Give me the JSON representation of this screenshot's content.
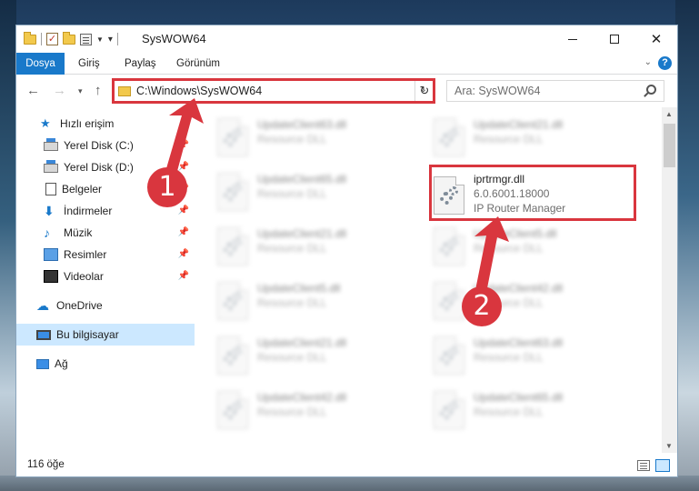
{
  "window": {
    "title": "SysWOW64"
  },
  "ribbon": {
    "tabs": [
      {
        "label": "Dosya"
      },
      {
        "label": "Giriş"
      },
      {
        "label": "Paylaş"
      },
      {
        "label": "Görünüm"
      }
    ],
    "help": "?"
  },
  "address": {
    "path": "C:\\Windows\\SysWOW64",
    "search_placeholder": "Ara: SysWOW64"
  },
  "sidebar": {
    "items": [
      {
        "label": "Hızlı erişim",
        "icon": "star-icon",
        "pinned": false
      },
      {
        "label": "Yerel Disk (C:)",
        "icon": "disk-icon",
        "pinned": true
      },
      {
        "label": "Yerel Disk (D:)",
        "icon": "disk-icon",
        "pinned": true
      },
      {
        "label": "Belgeler",
        "icon": "document-icon",
        "pinned": true
      },
      {
        "label": "İndirmeler",
        "icon": "download-icon",
        "pinned": true
      },
      {
        "label": "Müzik",
        "icon": "music-icon",
        "pinned": true
      },
      {
        "label": "Resimler",
        "icon": "pictures-icon",
        "pinned": true
      },
      {
        "label": "Videolar",
        "icon": "video-icon",
        "pinned": true
      },
      {
        "label": "OneDrive",
        "icon": "cloud-icon",
        "pinned": false
      },
      {
        "label": "Bu bilgisayar",
        "icon": "computer-icon",
        "pinned": false,
        "selected": true
      },
      {
        "label": "Ağ",
        "icon": "network-icon",
        "pinned": false
      }
    ]
  },
  "files": {
    "left_column": [
      {
        "name": "UpdateClient63.dll",
        "type": "Resource DLL"
      },
      {
        "name": "UpdateClient65.dll",
        "type": "Resource DLL"
      },
      {
        "name": "UpdateClient21.dll",
        "type": "Resource DLL"
      },
      {
        "name": "UpdateClient5.dll",
        "type": "Resource DLL"
      },
      {
        "name": "UpdateClient21.dll",
        "type": "Resource DLL"
      },
      {
        "name": "UpdateClient42.dll",
        "type": "Resource DLL"
      }
    ],
    "right_column": [
      {
        "name": "UpdateClient21.dll",
        "type": "Resource DLL"
      },
      {
        "name": "iprtrmgr.dll",
        "version": "6.0.6001.18000",
        "description": "IP Router Manager",
        "highlighted": true
      },
      {
        "name": "UpdateClient5.dll",
        "type": "Resource DLL"
      },
      {
        "name": "UpdateClient42.dll",
        "type": "Resource DLL"
      },
      {
        "name": "UpdateClient63.dll",
        "type": "Resource DLL"
      },
      {
        "name": "UpdateClient65.dll",
        "type": "Resource DLL"
      }
    ]
  },
  "status": {
    "count": "116 öğe"
  },
  "annotations": {
    "step1": "1",
    "step2": "2",
    "color": "#d9363e"
  }
}
